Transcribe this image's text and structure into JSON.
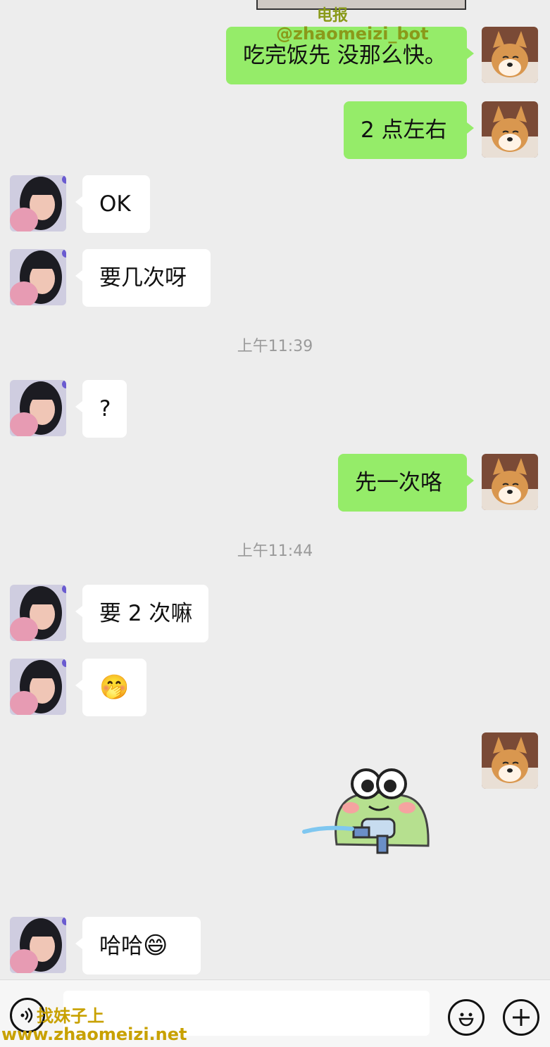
{
  "watermarks": {
    "top_line1": "电报",
    "top_line2": "@zhaomeizi_bot",
    "bottom_line1": "找妹子上",
    "bottom_line2": "www.zhaomeizi.net"
  },
  "messages": [
    {
      "side": "me",
      "text": "吃完饭先 没那么快。"
    },
    {
      "side": "me",
      "text": "2 点左右"
    },
    {
      "side": "them",
      "text": "OK"
    },
    {
      "side": "them",
      "text": "要几次呀"
    },
    {
      "side": "time",
      "text": "上午11:39"
    },
    {
      "side": "them",
      "text": "?"
    },
    {
      "side": "me",
      "text": "先一次咯"
    },
    {
      "side": "time",
      "text": "上午11:44"
    },
    {
      "side": "them",
      "text": "要 2 次嘛"
    },
    {
      "side": "them",
      "emoji": "🤭"
    },
    {
      "side": "me",
      "sticker": "frog-water-gun-sticker"
    },
    {
      "side": "them",
      "text": "哈哈",
      "emoji": "😄"
    }
  ],
  "input_bar": {
    "voice_icon": "voice-icon",
    "emoji_icon": "smiley-icon",
    "more_icon": "plus-icon"
  },
  "colors": {
    "background": "#ededed",
    "my_bubble": "#95ec69",
    "their_bubble": "#ffffff",
    "timestamp": "#9a9a9a"
  }
}
